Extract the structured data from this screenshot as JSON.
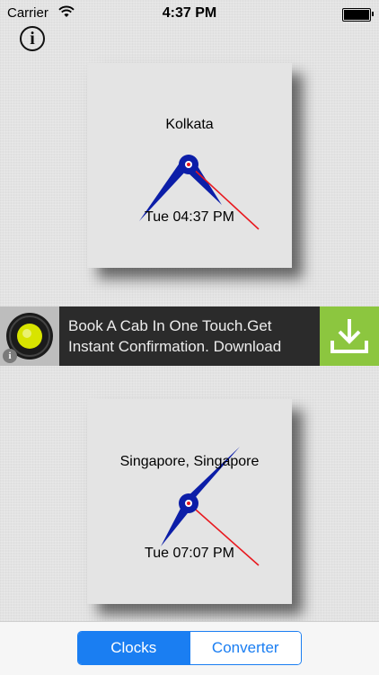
{
  "status_bar": {
    "carrier": "Carrier",
    "time": "4:37 PM"
  },
  "info_button": {
    "glyph": "i"
  },
  "clocks": [
    {
      "city": "Kolkata",
      "time_label": "Tue 04:37 PM"
    },
    {
      "city": "Singapore, Singapore",
      "time_label": "Tue 07:07 PM"
    }
  ],
  "ad": {
    "text": "Book A Cab In One Touch.Get Instant Confirmation. Download",
    "info_glyph": "i"
  },
  "tabs": {
    "clocks_label": "Clocks",
    "converter_label": "Converter"
  },
  "colors": {
    "accent": "#1a7ef2",
    "hour_hand": "#0c1ea8",
    "second_hand": "#e8191f",
    "ad_download": "#8cc63f"
  }
}
